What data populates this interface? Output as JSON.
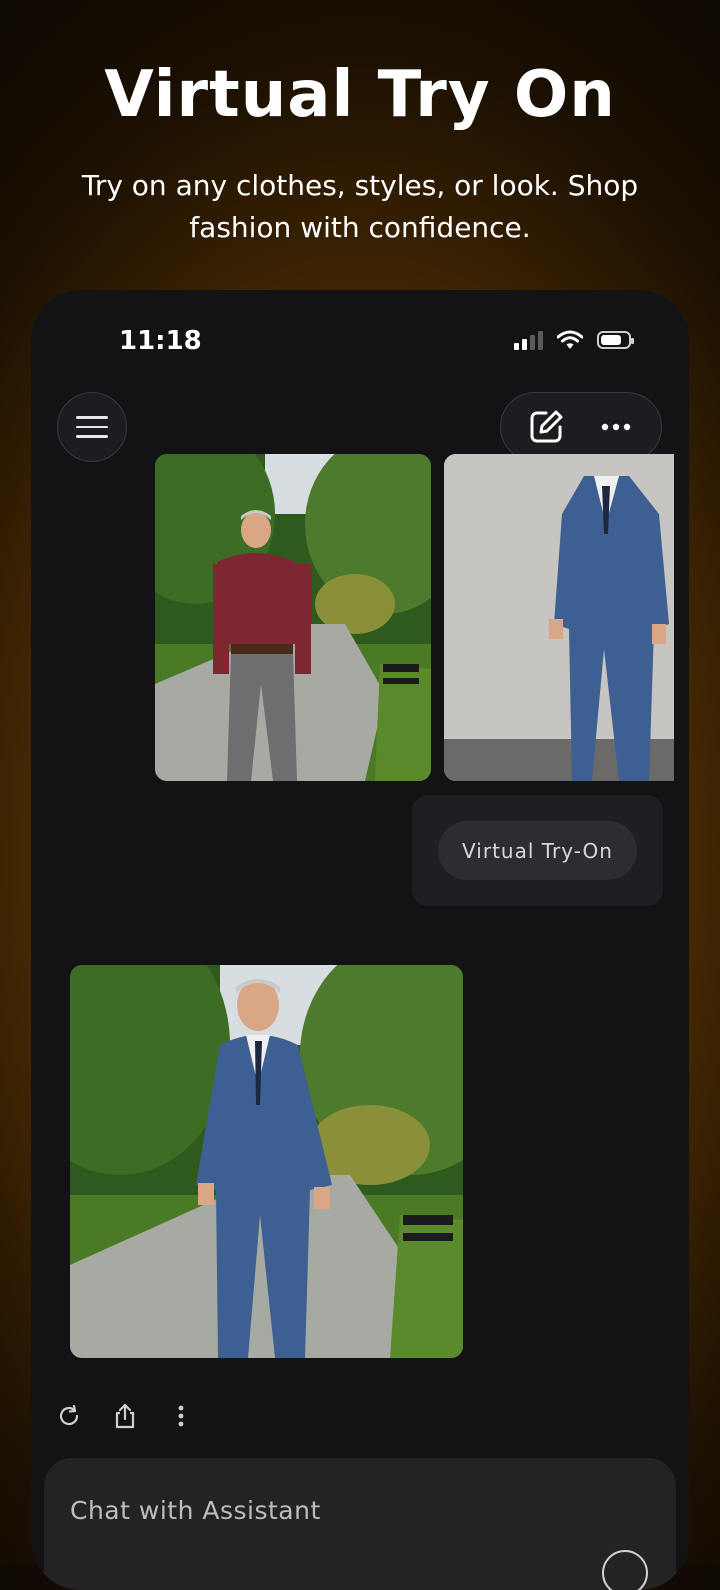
{
  "promo": {
    "title": "Virtual Try On",
    "subtitle": "Try on any clothes, styles, or look. Shop fashion with confidence."
  },
  "status_bar": {
    "time": "11:18",
    "icons": [
      "signal-icon",
      "wifi-icon",
      "battery-icon"
    ]
  },
  "header": {
    "menu_icon": "hamburger-icon",
    "actions": [
      "edit-icon",
      "more-horizontal-icon"
    ]
  },
  "conversation": {
    "user_images": [
      "person-photo",
      "suit-photo"
    ],
    "prompt_chip": "Virtual Try-On",
    "result_image": "tryon-result-photo",
    "message_actions": [
      "refresh-icon",
      "share-icon",
      "more-vertical-icon"
    ]
  },
  "composer": {
    "placeholder": "Chat with Assistant"
  },
  "colors": {
    "background_glow": "#7a4a05",
    "phone_bg": "#131316",
    "card_bg": "#1f1f23",
    "chip_bg": "#2d2d31",
    "composer_bg": "#232326"
  }
}
